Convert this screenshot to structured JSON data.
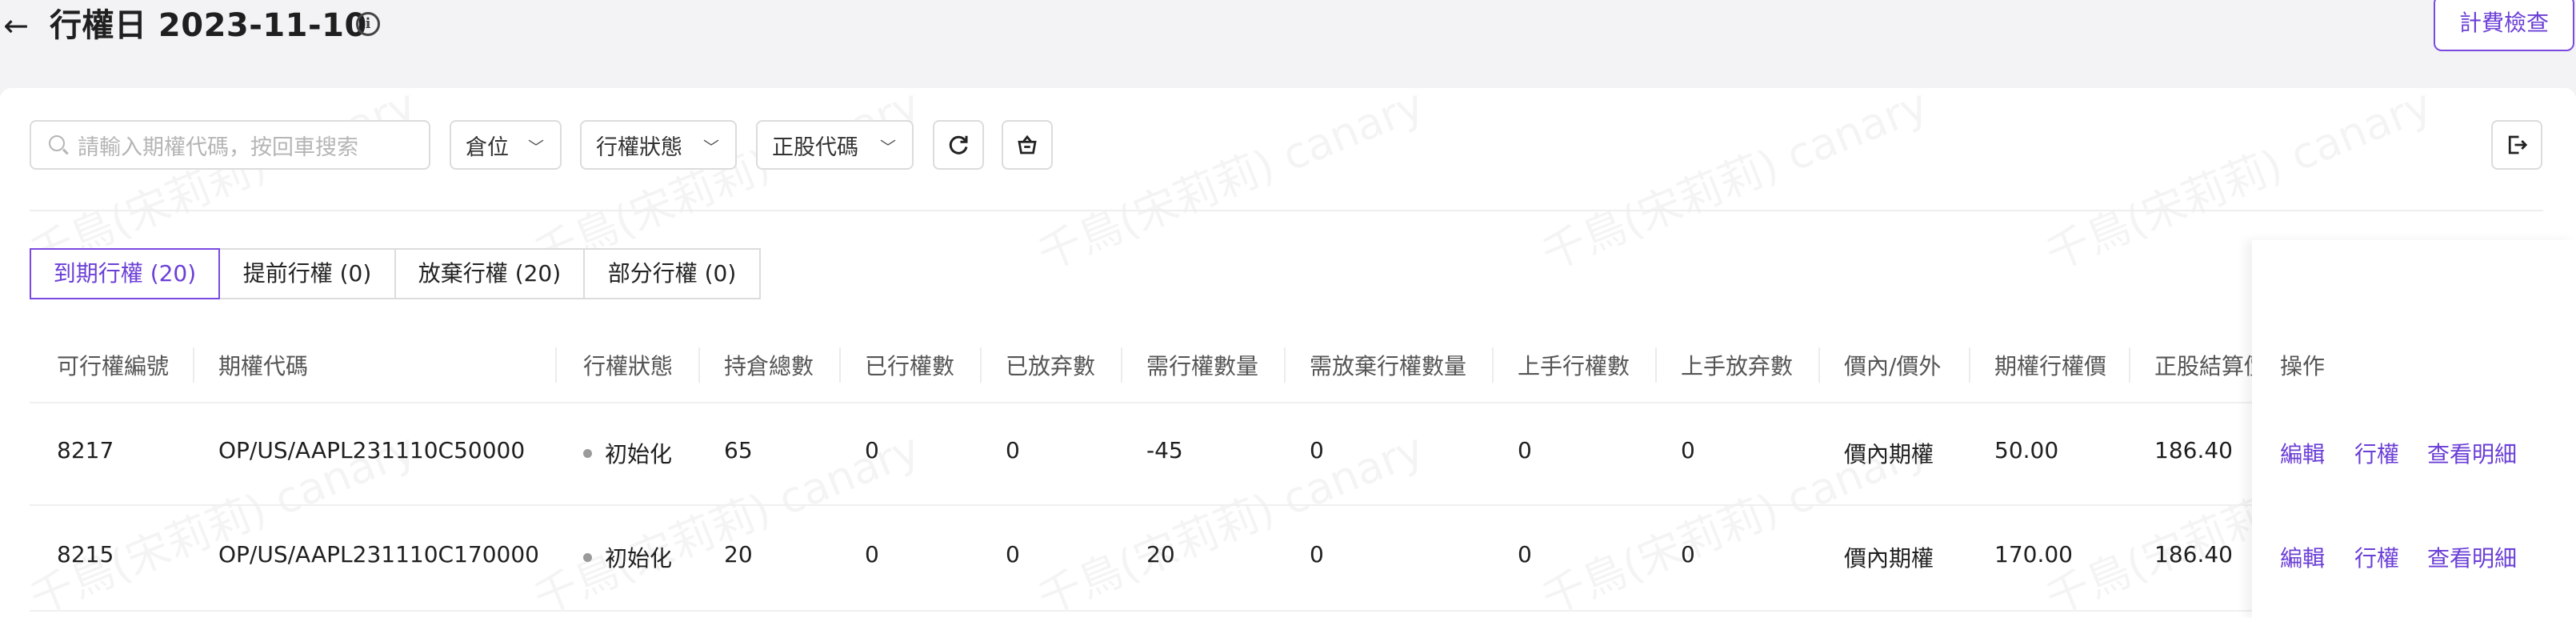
{
  "header": {
    "title": "行權日 2023-11-10",
    "billing_button": "計費檢查"
  },
  "toolbar": {
    "search_placeholder": "請輸入期權代碼，按回車搜索",
    "filters": [
      "倉位",
      "行權狀態",
      "正股代碼"
    ]
  },
  "watermark": "千鳥(宋莉莉) canary",
  "tabs": [
    {
      "label": "到期行權 (20)",
      "active": true
    },
    {
      "label": "提前行權 (0)",
      "active": false
    },
    {
      "label": "放棄行權 (20)",
      "active": false
    },
    {
      "label": "部分行權 (0)",
      "active": false
    }
  ],
  "table": {
    "columns": [
      "可行權編號",
      "期權代碼",
      "行權狀態",
      "持倉總數",
      "已行權數",
      "已放弃數",
      "需行權數量",
      "需放棄行權數量",
      "上手行權數",
      "上手放弃數",
      "價內/價外",
      "期權行權價",
      "正股結算價",
      "操作"
    ],
    "rows": [
      {
        "id": "8217",
        "code": "OP/US/AAPL231110C50000",
        "status": "初始化",
        "total": "65",
        "exercised": "0",
        "abandoned": "0",
        "need_exercise": "-45",
        "need_abandon": "0",
        "upstream_exercise": "0",
        "upstream_abandon": "0",
        "moneyness": "價內期權",
        "strike": "50.00",
        "settle": "186.40"
      },
      {
        "id": "8215",
        "code": "OP/US/AAPL231110C170000",
        "status": "初始化",
        "total": "20",
        "exercised": "0",
        "abandoned": "0",
        "need_exercise": "20",
        "need_abandon": "0",
        "upstream_exercise": "0",
        "upstream_abandon": "0",
        "moneyness": "價內期權",
        "strike": "170.00",
        "settle": "186.40"
      }
    ],
    "actions": [
      "編輯",
      "行權",
      "查看明細"
    ]
  },
  "colors": {
    "accent": "#6b3fd6",
    "accent_border": "#7a4ae0",
    "page_bg": "#f3f3f5"
  },
  "icons": [
    "back-arrow-icon",
    "info-icon",
    "search-icon",
    "chevron-down-icon",
    "refresh-icon",
    "basket-icon",
    "export-icon"
  ]
}
